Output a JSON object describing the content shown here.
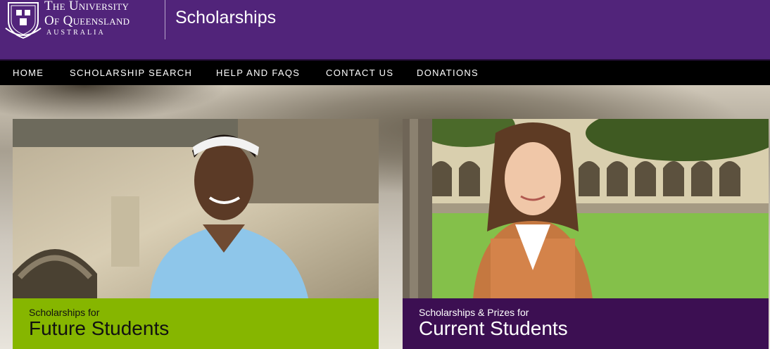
{
  "header": {
    "university_line1": "The University",
    "university_line2": "Of Queensland",
    "university_line3": "AUSTRALIA",
    "site_title": "Scholarships",
    "bg_color": "#51247a"
  },
  "nav": {
    "items": [
      {
        "label": "HOME"
      },
      {
        "label": "SCHOLARSHIP SEARCH"
      },
      {
        "label": "HELP AND FAQS"
      },
      {
        "label": "CONTACT US"
      },
      {
        "label": "DONATIONS"
      }
    ]
  },
  "cards": [
    {
      "small": "Scholarships for",
      "big": "Future Students",
      "color": "#86b600"
    },
    {
      "small": "Scholarships & Prizes for",
      "big": "Current Students",
      "color": "#3c0f52"
    }
  ]
}
